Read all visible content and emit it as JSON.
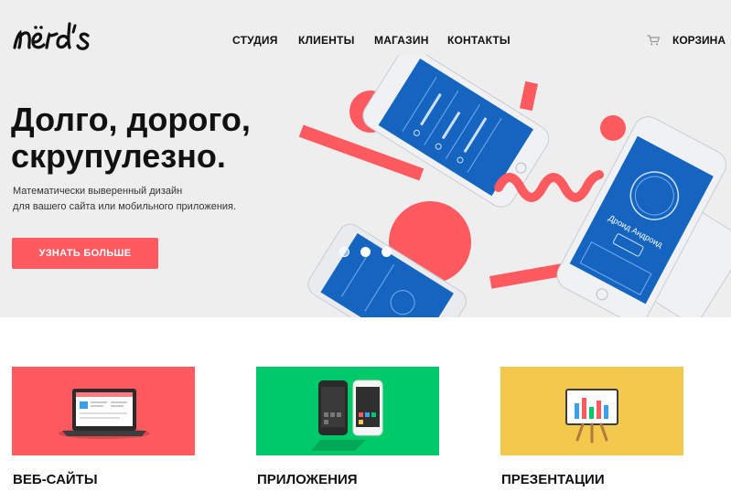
{
  "header": {
    "logo_text": "nërd's",
    "nav": [
      "СТУДИЯ",
      "КЛИЕНТЫ",
      "МАГАЗИН",
      "КОНТАКТЫ"
    ],
    "cart_label": "КОРЗИНА",
    "cart_icon": "cart-icon"
  },
  "hero": {
    "headline": [
      "Долго, дорого,",
      "скрупулезно."
    ],
    "subtitle": [
      "Математически выверенный дизайн",
      "для вашего сайта или мобильного приложения."
    ],
    "cta_label": "УЗНАТЬ БОЛЬШЕ",
    "slider": {
      "slide_count": 3,
      "active_index": 0
    },
    "phone_text": "Дроид Андроид"
  },
  "services": [
    {
      "title": "ВЕБ-САЙТЫ",
      "tile_color": "#ff5a5f",
      "icon": "laptop-icon"
    },
    {
      "title": "ПРИЛОЖЕНИЯ",
      "tile_color": "#00c96a",
      "icon": "phones-icon"
    },
    {
      "title": "ПРЕЗЕНТАЦИИ",
      "tile_color": "#f2c94c",
      "icon": "presentation-board-icon"
    }
  ],
  "colors": {
    "accent": "#ff5a5f",
    "hero_bg": "#eeeeee",
    "phone_screen": "#1565c0",
    "apps_green": "#00c96a",
    "presentation_yellow": "#f2c94c"
  }
}
